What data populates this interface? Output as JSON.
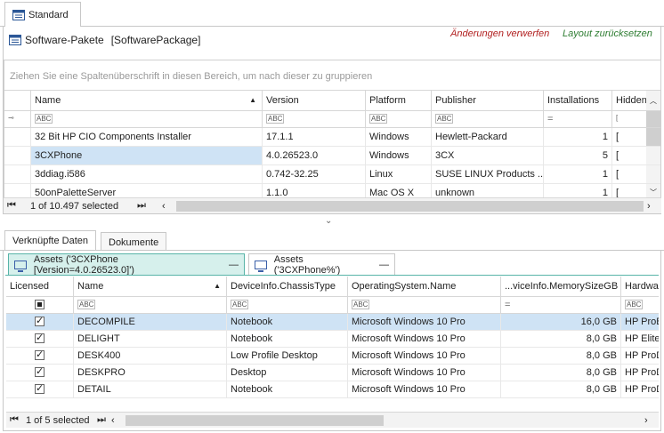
{
  "top_tab": {
    "label": "Standard"
  },
  "header": {
    "title": "Software-Pakete",
    "type_label": "[SoftwarePackage]",
    "discard_link": "Änderungen verwerfen",
    "reset_layout_link": "Layout zurücksetzen",
    "discard_color": "#b22222",
    "reset_color": "#2e7d32"
  },
  "grid1": {
    "group_hint": "Ziehen Sie eine Spaltenüberschrift in diesen Bereich, um nach dieser zu gruppieren",
    "columns": [
      "Name",
      "Version",
      "Platform",
      "Publisher",
      "Installations",
      "Hidden"
    ],
    "filter_abc": "ABC",
    "filter_eq": "=",
    "rows": [
      {
        "name": "32 Bit HP CIO Components Installer",
        "version": "17.1.1",
        "platform": "Windows",
        "publisher": "Hewlett-Packard",
        "installations": "1"
      },
      {
        "name": "3CXPhone",
        "version": "4.0.26523.0",
        "platform": "Windows",
        "publisher": "3CX",
        "installations": "5"
      },
      {
        "name": "3ddiag.i586",
        "version": "0.742-32.25",
        "platform": "Linux",
        "publisher": "SUSE LINUX Products ...",
        "installations": "1"
      },
      {
        "name": "50onPaletteServer",
        "version": "1.1.0",
        "platform": "Mac OS X",
        "publisher": "unknown",
        "installations": "1"
      }
    ],
    "footer_status": "1 of 10.497 selected"
  },
  "bottom_tabs": {
    "linked": "Verknüpfte Daten",
    "documents": "Dokumente"
  },
  "subtabs": {
    "active": "Assets ('3CXPhone [Version=4.0.26523.0]')",
    "other": "Assets ('3CXPhone%')",
    "collapse": "—"
  },
  "grid2": {
    "columns": [
      "Licensed",
      "Name",
      "DeviceInfo.ChassisType",
      "OperatingSystem.Name",
      "...viceInfo.MemorySizeGB",
      "Hardwa"
    ],
    "rows": [
      {
        "name": "DECOMPILE",
        "chassis": "Notebook",
        "os": "Microsoft Windows 10 Pro",
        "mem": "16,0 GB",
        "hw": "HP ProB"
      },
      {
        "name": "DELIGHT",
        "chassis": "Notebook",
        "os": "Microsoft Windows 10 Pro",
        "mem": "8,0 GB",
        "hw": "HP Elite"
      },
      {
        "name": "DESK400",
        "chassis": "Low Profile Desktop",
        "os": "Microsoft Windows 10 Pro",
        "mem": "8,0 GB",
        "hw": "HP ProD"
      },
      {
        "name": "DESKPRO",
        "chassis": "Desktop",
        "os": "Microsoft Windows 10 Pro",
        "mem": "8,0 GB",
        "hw": "HP ProD"
      },
      {
        "name": "DETAIL",
        "chassis": "Notebook",
        "os": "Microsoft Windows 10 Pro",
        "mem": "8,0 GB",
        "hw": "HP ProD"
      }
    ],
    "footer_status": "1 of 5 selected"
  },
  "colors": {
    "selected_row": "#cfe3f5",
    "active_tab": "#d6f0ec",
    "accent": "#2aa198"
  }
}
